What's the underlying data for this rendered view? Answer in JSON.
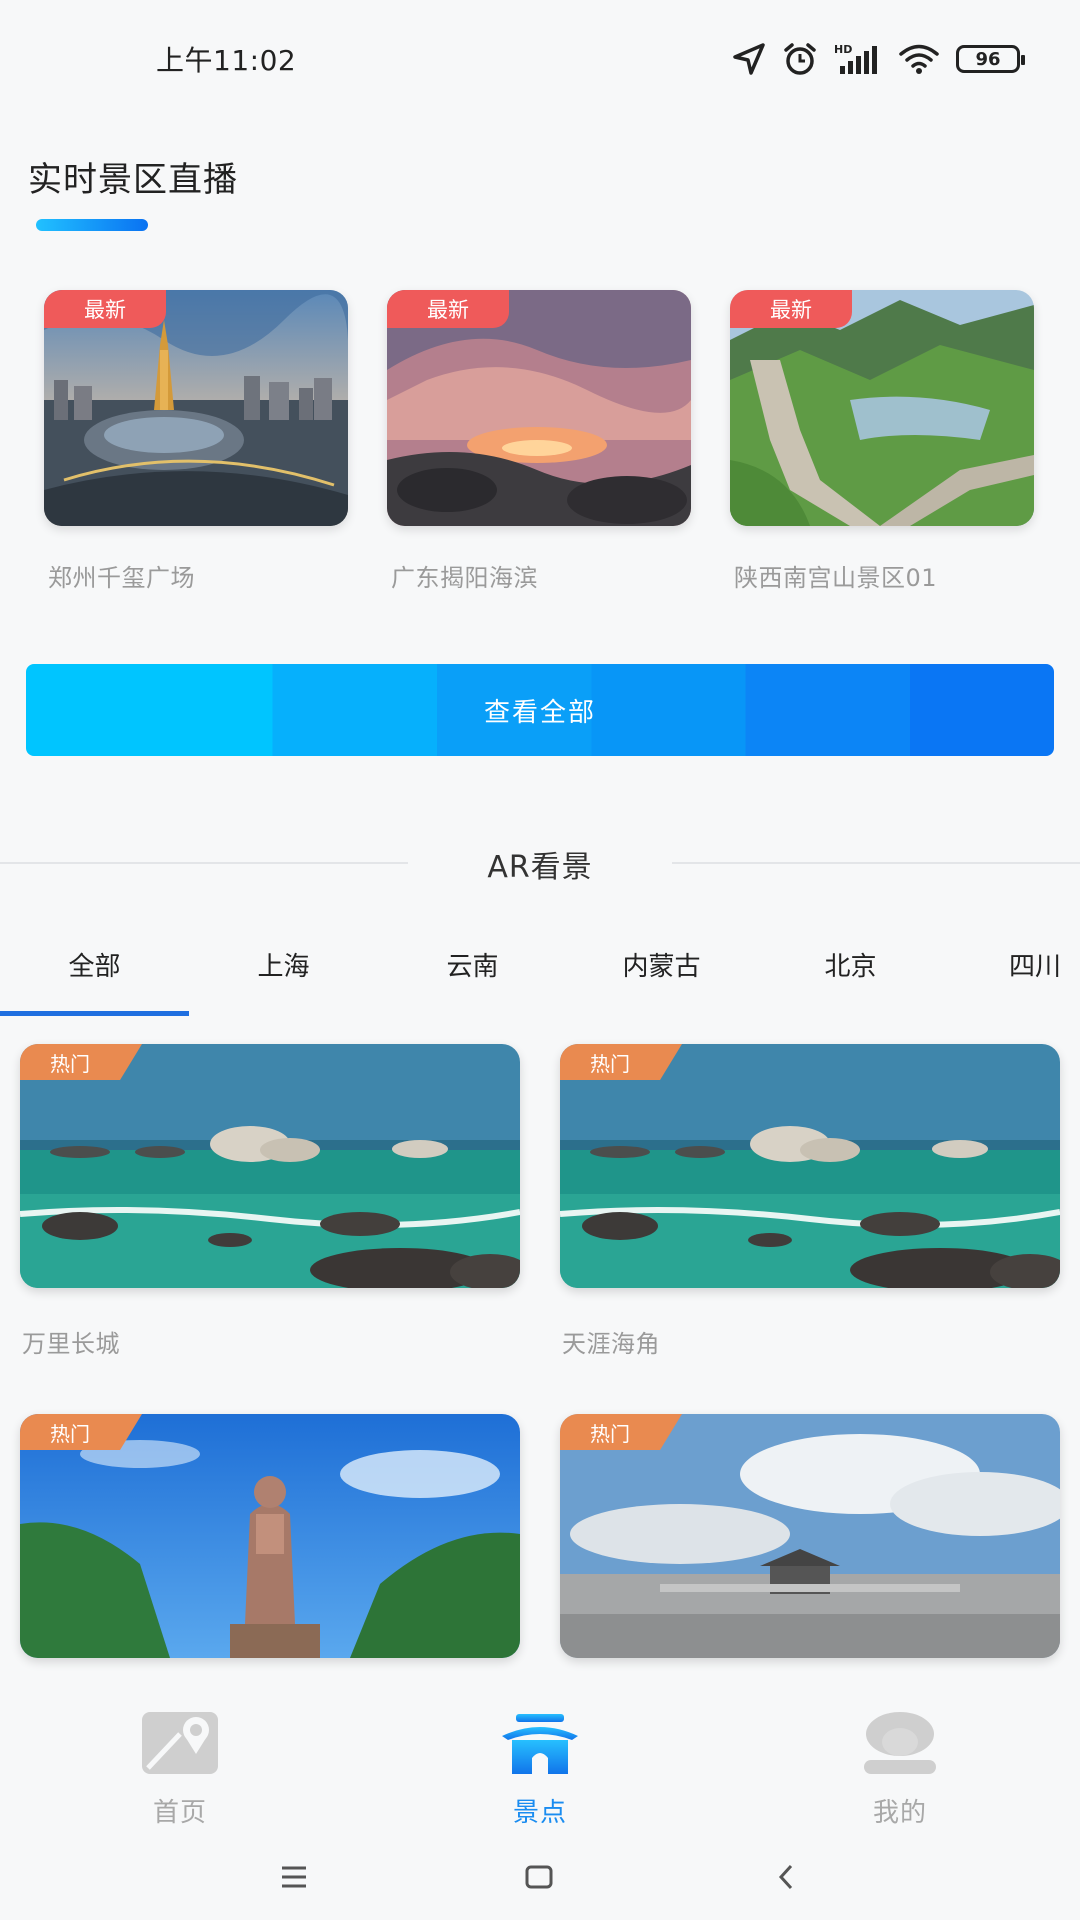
{
  "status_bar": {
    "time": "上午11:02",
    "battery": "96",
    "icons": [
      "location-icon",
      "alarm-icon",
      "hd-signal-icon",
      "wifi-icon",
      "battery-icon"
    ]
  },
  "live_section": {
    "title": "实时景区直播",
    "badge": "最新",
    "items": [
      {
        "name": "郑州千玺广场"
      },
      {
        "name": "广东揭阳海滨"
      },
      {
        "name": "陕西南宫山景区01"
      }
    ],
    "view_all": "查看全部"
  },
  "ar_section": {
    "title": "AR看景",
    "tabs": [
      "全部",
      "上海",
      "云南",
      "内蒙古",
      "北京",
      "四川"
    ],
    "active_tab": "全部",
    "badge": "热门",
    "spots": [
      {
        "name": "万里长城"
      },
      {
        "name": "天涯海角"
      },
      {
        "name": ""
      },
      {
        "name": ""
      }
    ]
  },
  "bottom_nav": {
    "items": [
      {
        "label": "首页",
        "icon": "map-icon",
        "active": false
      },
      {
        "label": "景点",
        "icon": "pavilion-icon",
        "active": true
      },
      {
        "label": "我的",
        "icon": "profile-icon",
        "active": false
      }
    ]
  },
  "system_nav": [
    "menu-icon",
    "home-icon",
    "back-icon"
  ],
  "colors": {
    "accent": "#1a8cf0",
    "badge_new": "#ef5a5a",
    "badge_hot": "#e98a50",
    "tab_indicator": "#1f6fe0"
  }
}
